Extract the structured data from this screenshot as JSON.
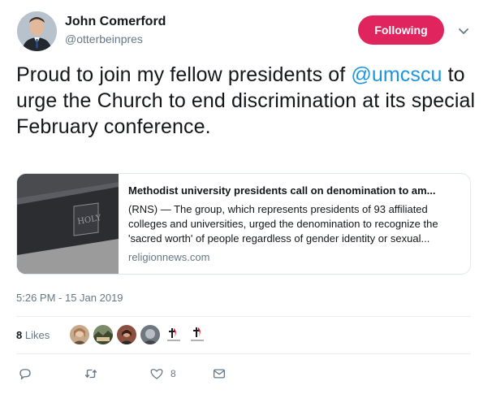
{
  "author": {
    "name": "John Comerford",
    "handle": "@otterbeinpres",
    "avatar_icon": "profile-photo"
  },
  "follow_button": {
    "label": "Following",
    "color": "#e0245e"
  },
  "menu": {
    "icon": "chevron-down-icon"
  },
  "tweet": {
    "text_before": "Proud to join my fellow presidents of ",
    "mention": "@umcscu",
    "text_after": " to urge the Church to end discrimination at its special February conference.",
    "mention_color": "#1b95e0"
  },
  "card": {
    "title": "Methodist university presidents call on denomination to am...",
    "description": "(RNS) — The group, which represents presidents of 93 affiliated colleges and universities, urged the denomination to recognize the 'sacred worth' of people regardless of gender identity or sexual...",
    "domain": "religionnews.com",
    "image_icon": "bible-photo"
  },
  "timestamp": "5:26 PM - 15 Jan 2019",
  "likes": {
    "count": "8",
    "label": "Likes",
    "likers": [
      "liker-avatar-1",
      "liker-avatar-2",
      "liker-avatar-3",
      "liker-avatar-4",
      "cross-flame-logo",
      "cross-flame-logo"
    ]
  },
  "actions": {
    "reply_icon": "reply-icon",
    "retweet_icon": "retweet-icon",
    "like_icon": "heart-icon",
    "like_count": "8",
    "dm_icon": "envelope-icon"
  }
}
